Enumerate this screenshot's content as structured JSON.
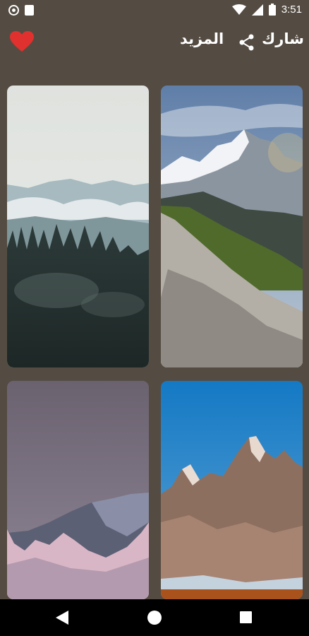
{
  "status_bar": {
    "time": "3:51"
  },
  "toolbar": {
    "share_label": "شارك",
    "more_label": "المزيد"
  },
  "colors": {
    "background": "#544c42",
    "heart": "#e0312f"
  },
  "icons": [
    "notification-dot-icon",
    "sd-card-icon",
    "wifi-icon",
    "signal-icon",
    "battery-icon",
    "heart-icon",
    "share-icon",
    "nav-back-icon",
    "nav-home-icon",
    "nav-recents-icon"
  ],
  "wallpapers": [
    "misty-forest",
    "sunlit-mountain-ridge",
    "pink-dusk-peaks",
    "rocky-peak-blue-sky"
  ]
}
